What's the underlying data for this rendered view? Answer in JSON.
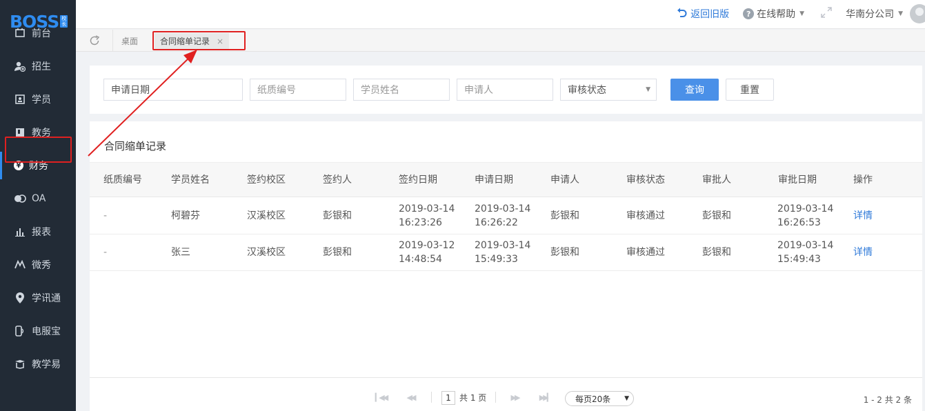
{
  "logo": {
    "text": "BOSS",
    "badge_top": "校",
    "badge_bottom": "长"
  },
  "header": {
    "back_old": "返回旧版",
    "help": "在线帮助",
    "help_icon": "?",
    "company": "华南分公司"
  },
  "sidebar": {
    "items": [
      {
        "label": "前台",
        "icon": "desk-icon"
      },
      {
        "label": "招生",
        "icon": "user-add-icon"
      },
      {
        "label": "学员",
        "icon": "student-icon"
      },
      {
        "label": "教务",
        "icon": "book-icon"
      },
      {
        "label": "财务",
        "icon": "yen-icon",
        "glyph": "¥"
      },
      {
        "label": "OA",
        "icon": "oa-icon"
      },
      {
        "label": "报表",
        "icon": "chart-icon"
      },
      {
        "label": "微秀",
        "icon": "weixiu-icon"
      },
      {
        "label": "学讯通",
        "icon": "location-icon"
      },
      {
        "label": "电服宝",
        "icon": "phone-icon"
      },
      {
        "label": "教学易",
        "icon": "teach-icon"
      }
    ]
  },
  "tabs": {
    "home": "桌面",
    "active": "合同缩单记录",
    "close": "×"
  },
  "filter": {
    "apply_date": "申请日期",
    "paper_no_placeholder": "纸质编号",
    "student_placeholder": "学员姓名",
    "applicant_placeholder": "申请人",
    "status": "审核状态",
    "query": "查询",
    "reset": "重置"
  },
  "table": {
    "title": "合同缩单记录",
    "columns": [
      "纸质编号",
      "学员姓名",
      "签约校区",
      "签约人",
      "签约日期",
      "申请日期",
      "申请人",
      "审核状态",
      "审批人",
      "审批日期",
      "操作"
    ],
    "rows": [
      {
        "paper_no": "-",
        "student": "柯碧芬",
        "campus": "汉溪校区",
        "signer": "彭银和",
        "sign_date": "2019-03-14",
        "sign_time": "16:23:26",
        "apply_date": "2019-03-14",
        "apply_time": "16:26:22",
        "applicant": "彭银和",
        "status": "审核通过",
        "approver": "彭银和",
        "approve_date": "2019-03-14",
        "approve_time": "16:26:53",
        "action": "详情"
      },
      {
        "paper_no": "-",
        "student": "张三",
        "campus": "汉溪校区",
        "signer": "彭银和",
        "sign_date": "2019-03-12",
        "sign_time": "14:48:54",
        "apply_date": "2019-03-14",
        "apply_time": "15:49:33",
        "applicant": "彭银和",
        "status": "审核通过",
        "approver": "彭银和",
        "approve_date": "2019-03-14",
        "approve_time": "15:49:43",
        "action": "详情"
      }
    ]
  },
  "pager": {
    "page": "1",
    "total_pages": "共 1 页",
    "page_size": "每页20条",
    "summary": "1 - 2   共 2 条"
  },
  "colors": {
    "accent": "#4a90e8",
    "sidebar_bg": "#222b36",
    "highlight": "#e02020"
  }
}
